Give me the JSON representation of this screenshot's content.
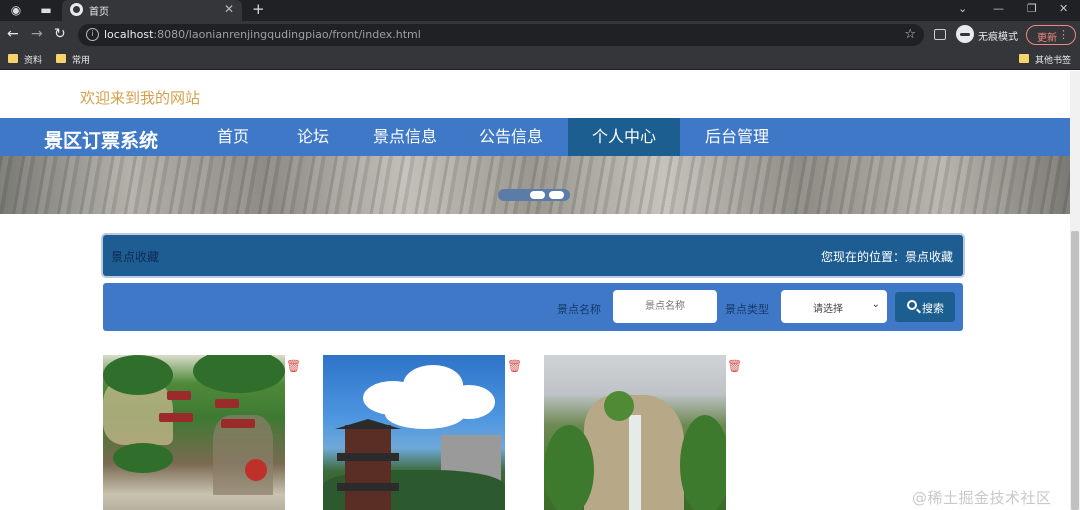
{
  "browser": {
    "tab_title": "首页",
    "url_host": "localhost",
    "url_path": ":8080/laonianrenjingqudingpiao/front/index.html",
    "incognito_label": "无痕模式",
    "update_label": "更新",
    "bookmarks": [
      "资料",
      "常用"
    ],
    "other_bookmarks": "其他书签"
  },
  "site": {
    "welcome": "欢迎来到我的网站",
    "brand": "景区订票系统",
    "nav": [
      "首页",
      "论坛",
      "景点信息",
      "公告信息",
      "个人中心",
      "后台管理"
    ],
    "active_nav": "个人中心"
  },
  "breadcrumb": {
    "section": "景点收藏",
    "location_label": "您现在的位置：",
    "location": "景点收藏"
  },
  "search": {
    "name_label": "景点名称",
    "name_placeholder": "景点名称",
    "type_label": "景点类型",
    "type_selected": "请选择",
    "button_label": "搜索"
  },
  "watermark": "@稀土掘金技术社区",
  "colors": {
    "nav_bg": "#3f78c6",
    "nav_active": "#1b5e8f",
    "welcome_text": "#d4a04c"
  }
}
